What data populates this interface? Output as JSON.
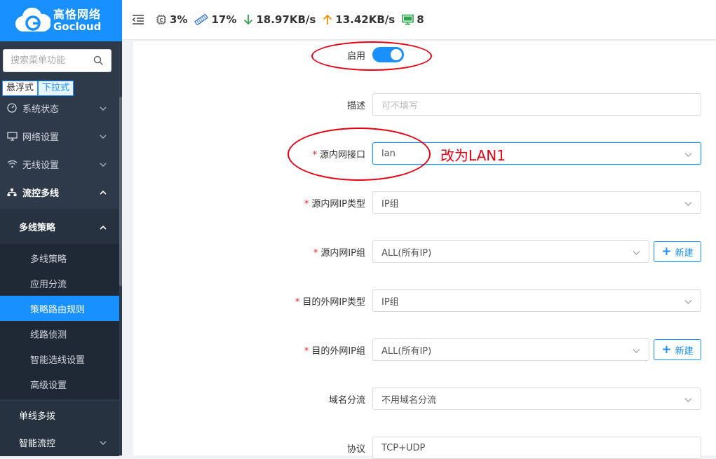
{
  "brand": {
    "cn": "高恪网络",
    "en": "Gocloud",
    "color": "#1890ff"
  },
  "sidebar": {
    "search_placeholder": "搜索菜单功能",
    "modes": [
      "悬浮式",
      "下拉式"
    ],
    "menu": [
      {
        "label": "系统状态",
        "icon": "dashboard-icon"
      },
      {
        "label": "网络设置",
        "icon": "monitor-icon"
      },
      {
        "label": "无线设置",
        "icon": "wifi-icon"
      },
      {
        "label": "流控多线",
        "icon": "network-icon"
      }
    ],
    "submenu_header": "多线策略",
    "subitems": [
      "多线策略",
      "应用分流",
      "策略路由规则",
      "线路侦测",
      "智能选线设置",
      "高级设置"
    ],
    "active_subitem": "策略路由规则",
    "bottom": [
      {
        "label": "单线多拨"
      },
      {
        "label": "智能流控"
      }
    ]
  },
  "topbar": {
    "cpu": "3%",
    "mem": "17%",
    "down": "18.97KB/s",
    "up": "13.42KB/s",
    "devices": "8"
  },
  "form": {
    "enable_label": "启用",
    "enable_value": true,
    "desc_label": "描述",
    "desc_placeholder": "可不填写",
    "src_iface_label": "源内网接口",
    "src_iface_value": "lan",
    "src_iptype_label": "源内网IP类型",
    "src_iptype_value": "IP组",
    "src_ipgroup_label": "源内网IP组",
    "src_ipgroup_value": "ALL(所有IP)",
    "dst_iptype_label": "目的外网IP类型",
    "dst_iptype_value": "IP组",
    "dst_ipgroup_label": "目的外网IP组",
    "dst_ipgroup_value": "ALL(所有IP)",
    "domain_label": "域名分流",
    "domain_value": "不用域名分流",
    "proto_label": "协议",
    "proto_value": "TCP+UDP",
    "new_button": "新建"
  },
  "annotation": {
    "text": "改为LAN1",
    "color": "#e60012"
  }
}
